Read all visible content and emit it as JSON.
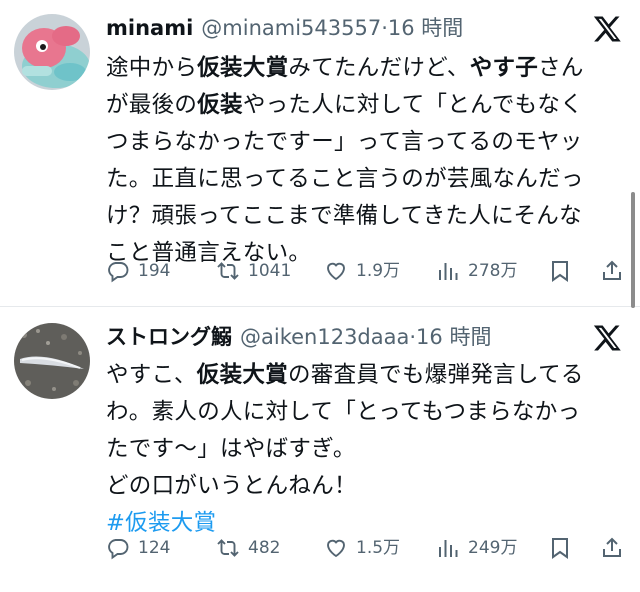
{
  "tweets": [
    {
      "display_name": "minami",
      "handle": "@minami543557",
      "time": "·16 時間",
      "text_segments": [
        {
          "t": "途中から",
          "b": false
        },
        {
          "t": "仮装大賞",
          "b": true
        },
        {
          "t": "みてたんだけど、",
          "b": false
        },
        {
          "t": "やす子",
          "b": true
        },
        {
          "t": "さんが最後の",
          "b": false
        },
        {
          "t": "仮装",
          "b": true
        },
        {
          "t": "やった人に対して「とんでもなくつまらなかったですー」って言ってるのモヤッた。正直に思ってること言うのが芸風なんだっけ？頑張ってここまで準備してきた人にそんなこと普通言えない。",
          "b": false
        }
      ],
      "lines": [
        [
          {
            "t": "途中から",
            "b": false
          },
          {
            "t": "仮装大賞",
            "b": true
          },
          {
            "t": "みてたんだけど、",
            "b": false
          },
          {
            "t": "やす子",
            "b": true
          },
          {
            "t": "さん",
            "b": false
          }
        ],
        [
          {
            "t": "が最後の",
            "b": false
          },
          {
            "t": "仮装",
            "b": true
          },
          {
            "t": "やった人に対して「とんでもなく",
            "b": false
          }
        ],
        [
          {
            "t": "つまらなかったですー」って言ってるのモヤッ",
            "b": false
          }
        ],
        [
          {
            "t": "た。正直に思ってること言うのが芸風なんだっ",
            "b": false
          }
        ],
        [
          {
            "t": "け？頑張ってここまで準備してきた人にそんな",
            "b": false
          }
        ],
        [
          {
            "t": "こと普通言えない。",
            "b": false
          }
        ]
      ],
      "replies": "194",
      "reposts": "1041",
      "likes": "1.9万",
      "views": "278万"
    },
    {
      "display_name": "ストロング鰯",
      "handle": "@aiken123daaa",
      "time": "·16 時間",
      "lines": [
        [
          {
            "t": "やすこ、",
            "b": false
          },
          {
            "t": "仮装大賞",
            "b": true
          },
          {
            "t": "の審査員でも爆弾発言してる",
            "b": false
          }
        ],
        [
          {
            "t": "わ。素人の人に対して「とってもつまらなかっ",
            "b": false
          }
        ],
        [
          {
            "t": "たです〜」はやばすぎ。",
            "b": false
          }
        ],
        [
          {
            "t": "どの口がいうとんねん！",
            "b": false
          }
        ]
      ],
      "hashtag": "#仮装大賞",
      "replies": "124",
      "reposts": "482",
      "likes": "1.5万",
      "views": "249万"
    }
  ],
  "icons": {
    "platform_logo": "x-logo-icon",
    "reply": "reply-bubble-icon",
    "repost": "repost-arrows-icon",
    "like": "heart-icon",
    "views": "bar-chart-icon",
    "bookmark": "bookmark-icon",
    "share": "share-upload-icon"
  },
  "colors": {
    "text": "#0f1419",
    "secondary": "#536471",
    "link": "#1d9bf0",
    "divider": "#e6e9ec"
  }
}
